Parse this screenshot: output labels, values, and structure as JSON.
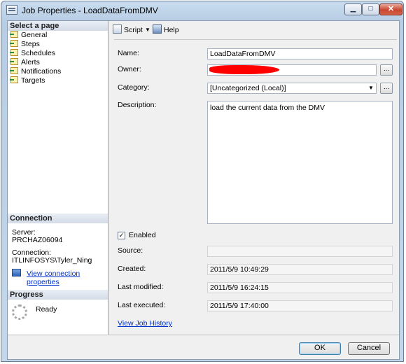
{
  "window": {
    "title": "Job Properties - LoadDataFromDMV"
  },
  "left": {
    "select_page_header": "Select a page",
    "pages": [
      "General",
      "Steps",
      "Schedules",
      "Alerts",
      "Notifications",
      "Targets"
    ],
    "connection_header": "Connection",
    "server_label": "Server:",
    "server_value": "PRCHAZ06094",
    "connection_label": "Connection:",
    "connection_value": "ITLINFOSYS\\Tyler_Ning",
    "view_connection_link": "View connection properties",
    "progress_header": "Progress",
    "progress_status": "Ready"
  },
  "toolbar": {
    "script_label": "Script",
    "help_label": "Help"
  },
  "form": {
    "name_label": "Name:",
    "name_value": "LoadDataFromDMV",
    "owner_label": "Owner:",
    "category_label": "Category:",
    "category_value": "[Uncategorized (Local)]",
    "description_label": "Description:",
    "description_value": "load the current data from the DMV",
    "enabled_label": "Enabled",
    "source_label": "Source:",
    "source_value": "",
    "created_label": "Created:",
    "created_value": "2011/5/9 10:49:29",
    "modified_label": "Last modified:",
    "modified_value": "2011/5/9 16:24:15",
    "executed_label": "Last executed:",
    "executed_value": "2011/5/9 17:40:00",
    "job_history_link": "View Job History",
    "browse_label": "..."
  },
  "buttons": {
    "ok": "OK",
    "cancel": "Cancel"
  },
  "colors": {
    "link": "#0033cc",
    "redaction": "#ff0000"
  }
}
